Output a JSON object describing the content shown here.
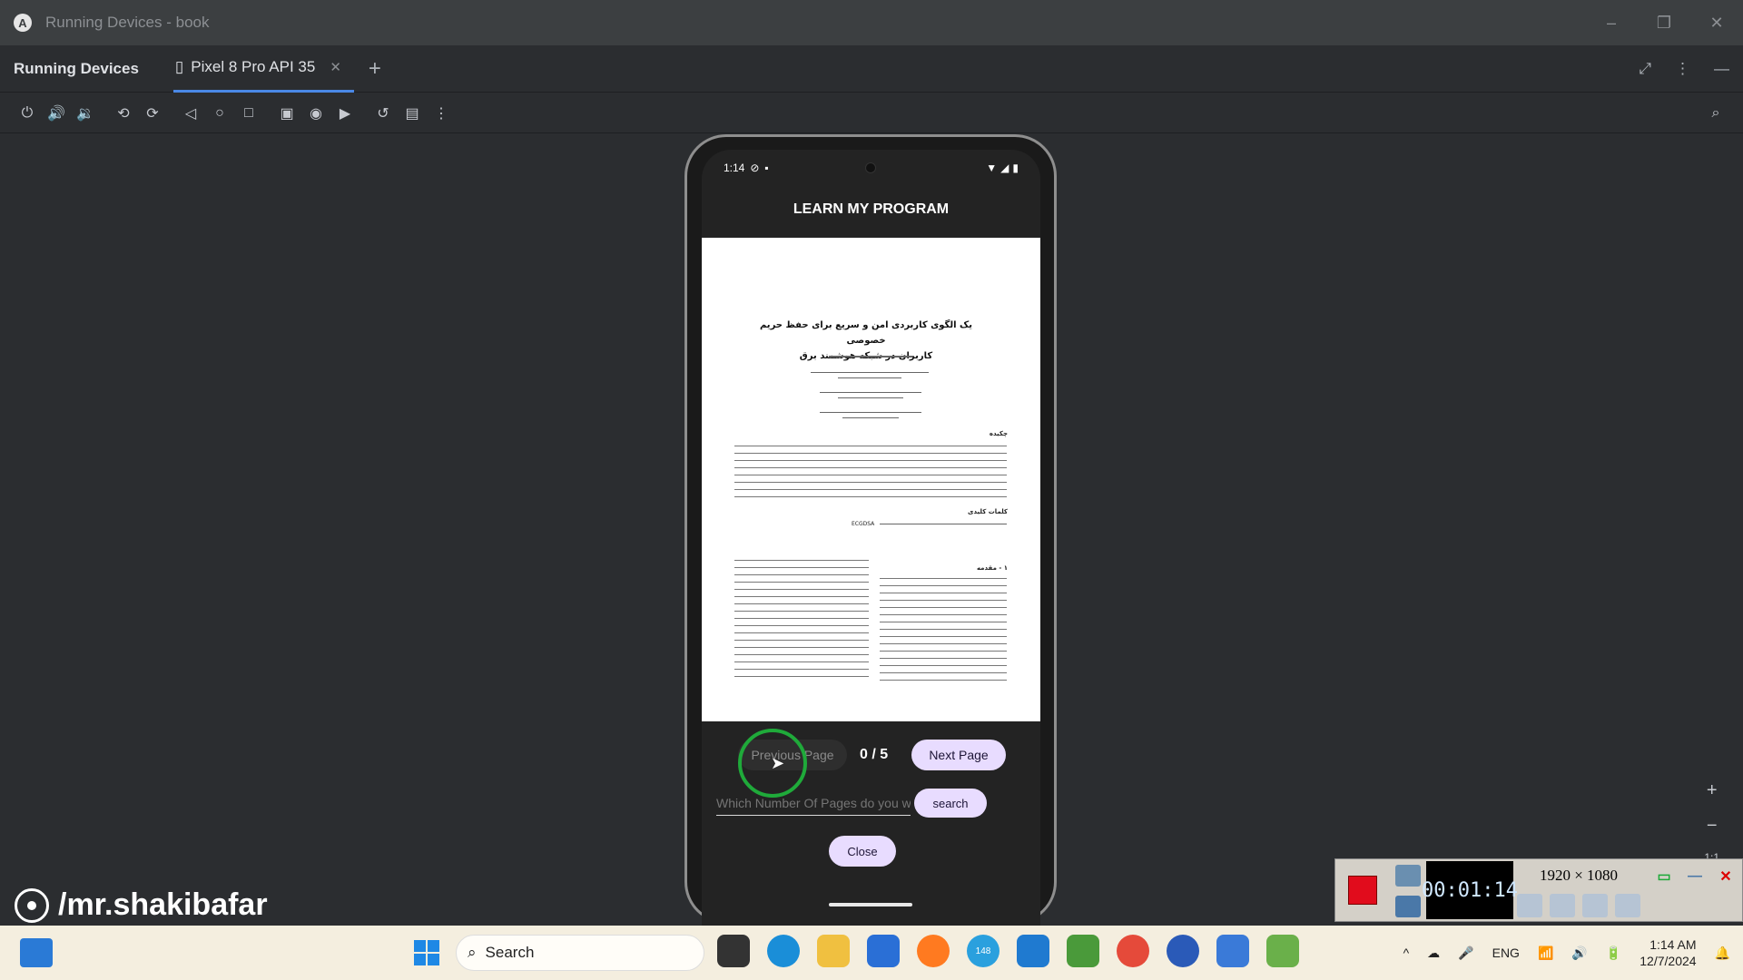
{
  "window": {
    "title": "Running Devices - book",
    "app_icon": "A",
    "controls": [
      "–",
      "❐",
      "✕"
    ]
  },
  "tabbar": {
    "panel_title": "Running Devices",
    "device_tab": "Pixel 8 Pro API 35"
  },
  "toolbar_icons": [
    "power-icon",
    "volume-up-icon",
    "volume-down-icon",
    "rotate-left-icon",
    "rotate-right-icon",
    "back-icon",
    "home-icon",
    "overview-icon",
    "device-frame-icon",
    "screenshot-icon",
    "record-icon",
    "reset-icon",
    "display-settings-icon",
    "more-icon"
  ],
  "phone": {
    "status_time": "1:14",
    "app_title": "LEARN MY PROGRAM",
    "pdf": {
      "title_line1": "یک الگوی کاربردی امن و سریع برای حفظ حریم خصوصی",
      "title_line2": "کاربران در شبکه هوشمند برق",
      "abstract_heading": "چکیده",
      "keywords_heading": "کلمات کلیدی",
      "keywords_tag": "ECGDSA",
      "intro_heading": "۱ - مقدمه"
    },
    "prev_label": "Previous Page",
    "page_count": "0 / 5",
    "next_label": "Next Page",
    "search_placeholder": "Which Number Of Pages do you want?",
    "search_label": "search",
    "close_label": "Close"
  },
  "zoom": {
    "plus": "+",
    "minus": "−",
    "ratio": "1:1"
  },
  "watermark": "/mr.shakibafar",
  "recorder": {
    "time": "00:01:14",
    "resolution": "1920 × 1080"
  },
  "taskbar": {
    "search_label": "Search",
    "badge": "148",
    "lang": "ENG",
    "time": "1:14 AM",
    "date": "12/7/2024"
  }
}
